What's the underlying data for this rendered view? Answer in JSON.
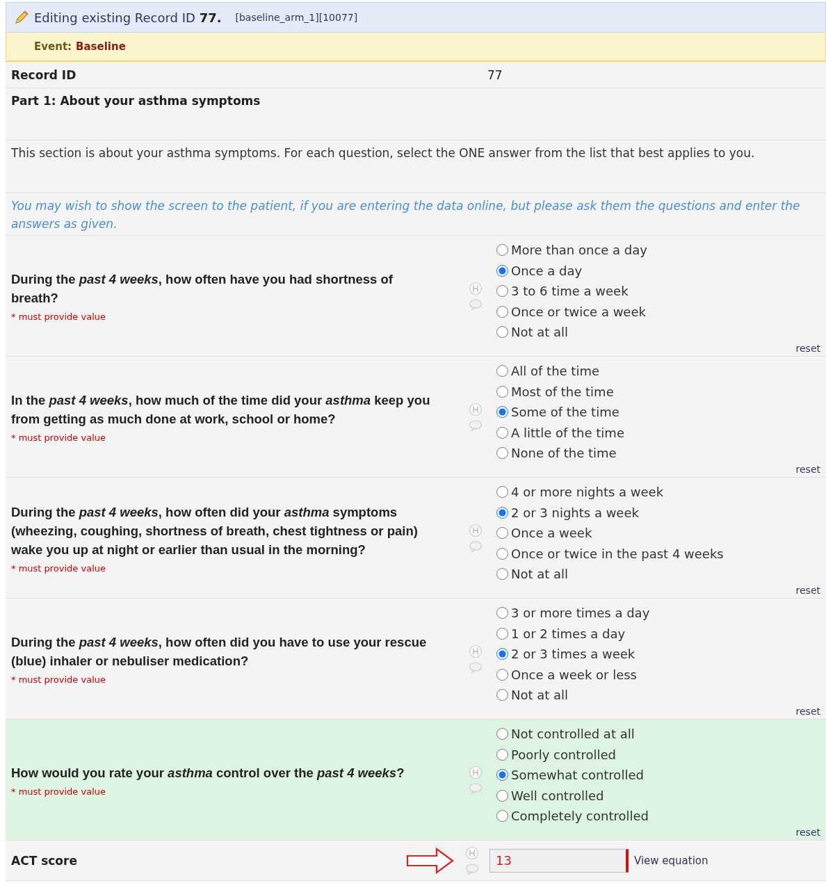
{
  "header": {
    "title_prefix": "Editing existing Record ID ",
    "record_id": "77.",
    "arm": "[baseline_arm_1][10077]"
  },
  "event": {
    "label": "Event:",
    "name": "Baseline"
  },
  "record_row": {
    "label": "Record ID",
    "value": "77"
  },
  "section_header": "Part 1: About your asthma symptoms",
  "instructions": "This section is about your asthma symptoms. For each question, select the ONE answer from the list that best applies to you.",
  "note": "You may wish to show the screen to the patient, if you are entering the data online, but please ask them the questions and enter the answers as given.",
  "questions": [
    {
      "text": "During the *past 4 weeks*, how often have you had shortness of breath?",
      "required": "* must provide value",
      "highlighted": false,
      "reset": "reset",
      "options": [
        {
          "label": "More than once a day",
          "selected": false
        },
        {
          "label": "Once a day",
          "selected": true
        },
        {
          "label": "3 to 6 time a week",
          "selected": false
        },
        {
          "label": "Once or twice a week",
          "selected": false
        },
        {
          "label": "Not at all",
          "selected": false
        }
      ]
    },
    {
      "text": "In the *past 4 weeks*, how much of the time did your *asthma* keep you from getting as much done at work, school or home?",
      "required": "* must provide value",
      "highlighted": false,
      "reset": "reset",
      "options": [
        {
          "label": "All of the time",
          "selected": false
        },
        {
          "label": "Most of the time",
          "selected": false
        },
        {
          "label": "Some of the time",
          "selected": true
        },
        {
          "label": "A little of the time",
          "selected": false
        },
        {
          "label": "None of the time",
          "selected": false
        }
      ]
    },
    {
      "text": "During the *past 4 weeks*, how often did your *asthma* symptoms (wheezing, coughing, shortness of breath, chest tightness or pain) wake you up at night or earlier than usual in the morning?",
      "required": "* must provide value",
      "highlighted": false,
      "reset": "reset",
      "options": [
        {
          "label": "4 or more nights a week",
          "selected": false
        },
        {
          "label": "2 or 3 nights a week",
          "selected": true
        },
        {
          "label": "Once a week",
          "selected": false
        },
        {
          "label": "Once or twice in the past 4 weeks",
          "selected": false
        },
        {
          "label": "Not at all",
          "selected": false
        }
      ]
    },
    {
      "text": "During the *past 4 weeks*, how often did you have to use your rescue (blue) inhaler or nebuliser medication?",
      "required": "* must provide value",
      "highlighted": false,
      "reset": "reset",
      "options": [
        {
          "label": "3 or more times a day",
          "selected": false
        },
        {
          "label": "1 or 2 times a day",
          "selected": false
        },
        {
          "label": "2 or 3 times a week",
          "selected": true
        },
        {
          "label": "Once a week or less",
          "selected": false
        },
        {
          "label": "Not at all",
          "selected": false
        }
      ]
    },
    {
      "text": "How would you rate your *asthma* control over the *past 4 weeks*?",
      "required": "* must provide value",
      "highlighted": true,
      "reset": "reset",
      "options": [
        {
          "label": "Not controlled at all",
          "selected": false
        },
        {
          "label": "Poorly controlled",
          "selected": false
        },
        {
          "label": "Somewhat controlled",
          "selected": true
        },
        {
          "label": "Well controlled",
          "selected": false
        },
        {
          "label": "Completely controlled",
          "selected": false
        }
      ]
    }
  ],
  "calc": {
    "label": "ACT score",
    "value": "13",
    "link": "View equation"
  }
}
